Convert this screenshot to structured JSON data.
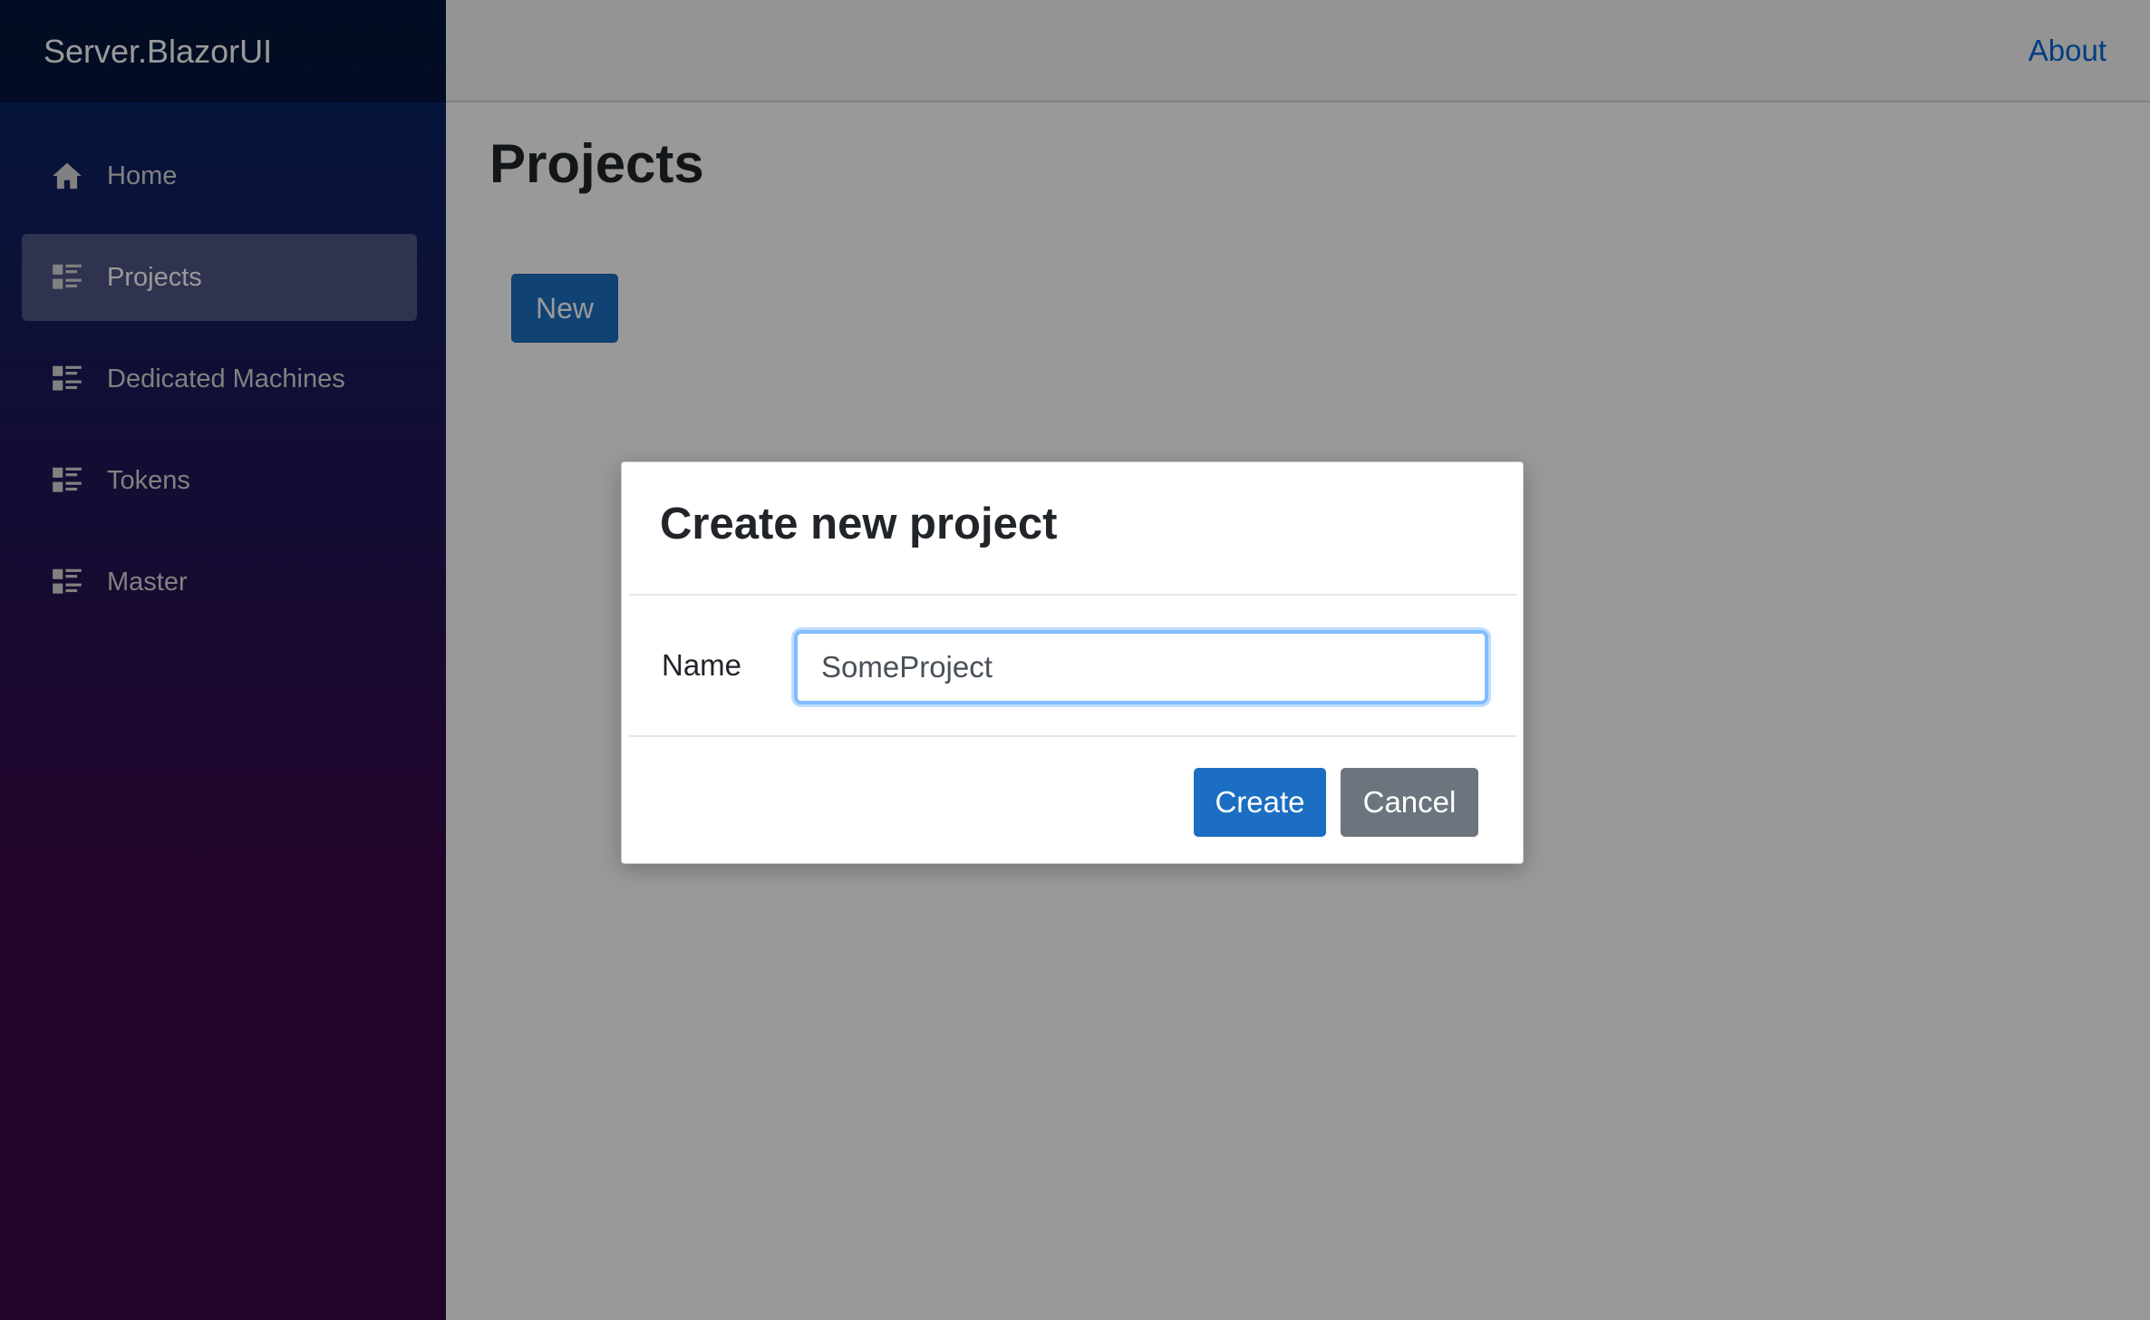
{
  "sidebar": {
    "brand": "Server.BlazorUI",
    "items": [
      {
        "label": "Home",
        "icon": "home-icon",
        "active": false
      },
      {
        "label": "Projects",
        "icon": "list-icon",
        "active": true
      },
      {
        "label": "Dedicated Machines",
        "icon": "list-icon",
        "active": false
      },
      {
        "label": "Tokens",
        "icon": "list-icon",
        "active": false
      },
      {
        "label": "Master",
        "icon": "list-icon",
        "active": false
      }
    ]
  },
  "topbar": {
    "about_label": "About"
  },
  "main": {
    "title": "Projects",
    "new_button_label": "New"
  },
  "modal": {
    "title": "Create new project",
    "name_label": "Name",
    "name_value": "SomeProject",
    "create_label": "Create",
    "cancel_label": "Cancel"
  },
  "colors": {
    "primary": "#1b6ec2",
    "secondary": "#6c757d",
    "link": "#0366d6"
  }
}
